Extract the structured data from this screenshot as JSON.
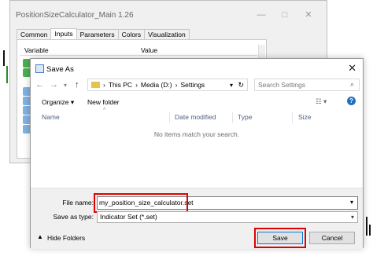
{
  "background_window": {
    "title": "PositionSizeCalculator_Main 1.26",
    "controls": [
      "—",
      "□",
      "✕"
    ],
    "tabs": [
      "Common",
      "Inputs",
      "Parameters",
      "Colors",
      "Visualization"
    ],
    "active_tab": "Inputs",
    "grid_headers": [
      "Variable",
      "Value"
    ]
  },
  "save_dialog": {
    "title": "Save As",
    "breadcrumb": [
      "This PC",
      "Media (D:)",
      "Settings"
    ],
    "search_placeholder": "Search Settings",
    "toolbar": {
      "organize": "Organize ▾",
      "new_folder": "New folder"
    },
    "columns": [
      "Name",
      "Date modified",
      "Type",
      "Size"
    ],
    "empty_message": "No items match your search.",
    "file_name_label": "File name:",
    "file_name_value": "my_position_size_calculator.set",
    "save_type_label": "Save as type:",
    "save_type_value": "Indicator Set (*.set)",
    "hide_folders": "Hide Folders",
    "save_button": "Save",
    "cancel_button": "Cancel"
  },
  "colors": {
    "highlight": "#e00000",
    "accent": "#0078d7"
  }
}
